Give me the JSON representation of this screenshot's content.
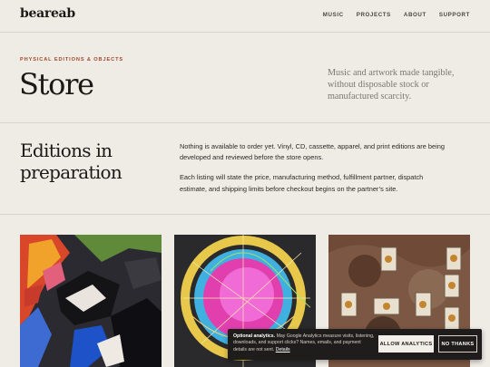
{
  "header": {
    "logo": "beareab",
    "nav": [
      "MUSIC",
      "PROJECTS",
      "ABOUT",
      "SUPPORT"
    ]
  },
  "hero": {
    "eyebrow": "PHYSICAL EDITIONS & OBJECTS",
    "title": "Store",
    "lede": "Music and artwork made tangible, without disposable stock or manufactured scarcity."
  },
  "editions": {
    "title": "Editions in preparation",
    "paragraphs": [
      "Nothing is available to order yet. Vinyl, CD, cassette, apparel, and print editions are being developed and reviewed before the store opens.",
      "Each listing will state the price, manufacturing method, fulfillment partner, dispatch estimate, and shipping limits before checkout begins on the partner’s site."
    ]
  },
  "gallery": {
    "images": [
      "abstract-painting",
      "color-circle-artwork",
      "tarot-card-spread"
    ]
  },
  "cookie": {
    "title": "Optional analytics.",
    "text": "May Google Analytics measure visits, listening, downloads, and support clicks? Names, emails, and payment details are not sent.",
    "details_link": "Details",
    "allow_label": "ALLOW ANALYTICS",
    "deny_label": "NO THANKS"
  },
  "colors": {
    "background": "#efece6",
    "accent": "#a3482c",
    "banner": "#1f1d1b"
  }
}
